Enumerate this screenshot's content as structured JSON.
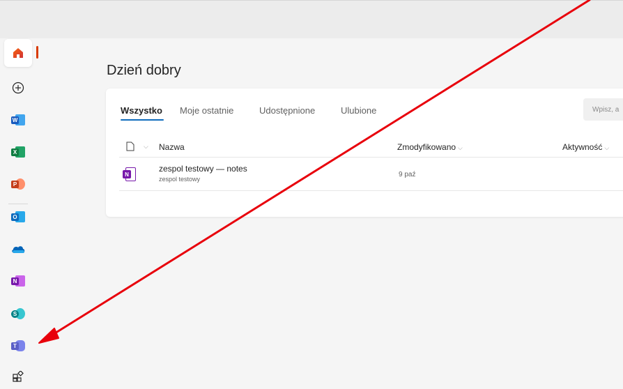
{
  "header": {
    "greeting": "Dzień dobry"
  },
  "tabs": [
    {
      "label": "Wszystko",
      "active": true
    },
    {
      "label": "Moje ostatnie",
      "active": false
    },
    {
      "label": "Udostępnione",
      "active": false
    },
    {
      "label": "Ulubione",
      "active": false
    }
  ],
  "search": {
    "placeholder": "Wpisz, a"
  },
  "table": {
    "columns": {
      "name": "Nazwa",
      "modified": "Zmodyfikowano",
      "activity": "Aktywność"
    },
    "rows": [
      {
        "name": "zespol testowy — notes",
        "location": "zespol testowy",
        "modified": "9 paź",
        "app_icon": "onenote-icon"
      }
    ]
  },
  "rail": {
    "items": [
      {
        "name": "home-icon",
        "active": true
      },
      {
        "name": "create-icon"
      },
      {
        "name": "word-icon",
        "letter": "W"
      },
      {
        "name": "excel-icon",
        "letter": "X"
      },
      {
        "name": "powerpoint-icon",
        "letter": "P"
      },
      {
        "name": "outlook-icon",
        "letter": "O"
      },
      {
        "name": "onedrive-icon"
      },
      {
        "name": "onenote-icon",
        "letter": "N"
      },
      {
        "name": "sharepoint-icon",
        "letter": "S"
      },
      {
        "name": "teams-icon",
        "letter": "T"
      },
      {
        "name": "all-apps-icon"
      }
    ]
  },
  "colors": {
    "accent": "#0f6cbd",
    "active_indicator": "#d83b01",
    "annotation_arrow": "#e8000b",
    "word": "#185abd",
    "excel": "#107c41",
    "powerpoint": "#c43e1c",
    "outlook": "#0f6cbd",
    "onedrive": "#0364b8",
    "onenote": "#7719aa",
    "sharepoint": "#038387",
    "teams": "#5b5fc7"
  }
}
